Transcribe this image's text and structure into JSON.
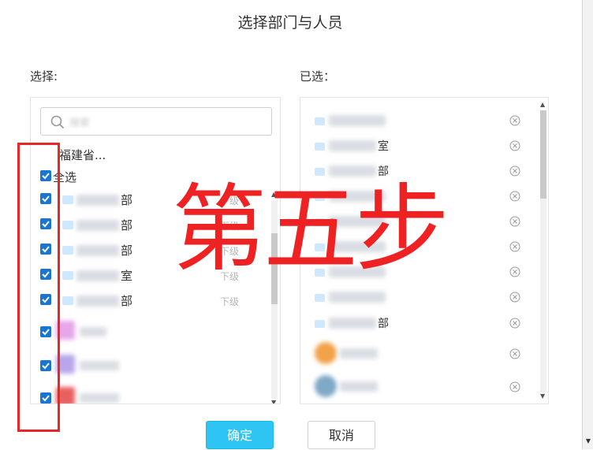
{
  "dialog": {
    "title": "选择部门与人员",
    "confirm_label": "确定",
    "cancel_label": "取消"
  },
  "left_panel": {
    "label": "选择:",
    "search_placeholder": "搜索",
    "breadcrumb": "福建省...",
    "select_all_label": "全选",
    "dept_rows": [
      {
        "suffix": "部",
        "sub_label": "下级",
        "checked": true
      },
      {
        "suffix": "部",
        "sub_label": "下级",
        "checked": true
      },
      {
        "suffix": "部",
        "sub_label": "下级",
        "checked": true
      },
      {
        "suffix": "室",
        "sub_label": "下级",
        "checked": true
      },
      {
        "suffix": "部",
        "sub_label": "下级",
        "checked": true
      }
    ],
    "people_rows": [
      {
        "checked": true,
        "avatar_color": "#e6a6ea"
      },
      {
        "checked": true,
        "avatar_color": "#b7a6ea"
      },
      {
        "checked": true,
        "avatar_color": "#e86060"
      }
    ]
  },
  "right_panel": {
    "label": "已选：",
    "items": [
      {
        "suffix": ""
      },
      {
        "suffix": "室"
      },
      {
        "suffix": "部"
      },
      {
        "suffix": ""
      },
      {
        "suffix": ""
      },
      {
        "suffix": ""
      },
      {
        "suffix": ""
      },
      {
        "suffix": ""
      },
      {
        "suffix": "部"
      }
    ],
    "people": [
      {
        "avatar_color": "#f2a24a"
      },
      {
        "avatar_color": "#7ea9c7"
      }
    ]
  },
  "overlay": {
    "step_text": "第五步"
  },
  "colors": {
    "checkbox": "#1876d2",
    "confirm_button": "#2ec4f3",
    "annotation_red": "#ee2222"
  }
}
